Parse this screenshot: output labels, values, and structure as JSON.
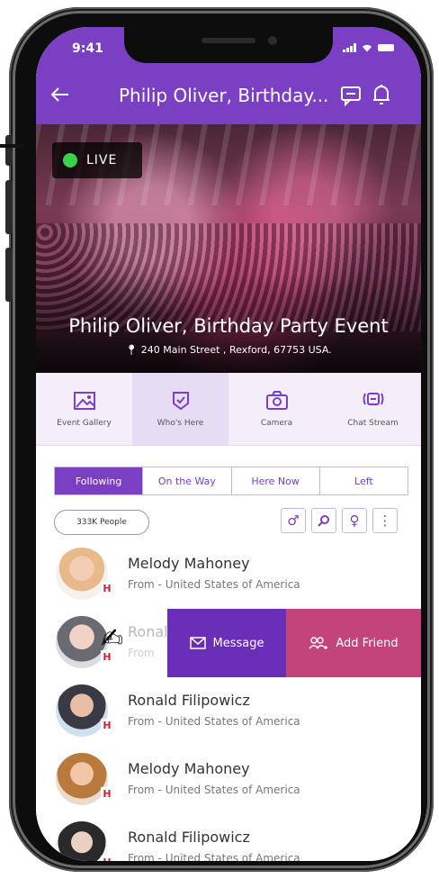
{
  "status": {
    "time": "9:41"
  },
  "header": {
    "title": "Philip Oliver, Birthday..."
  },
  "hero": {
    "live_label": "LIVE",
    "event_name": "Philip Oliver, Birthday Party Event",
    "address": "240 Main Street , Rexford, 67753 USA."
  },
  "tabs": [
    {
      "label": "Event Gallery",
      "icon": "gallery-icon"
    },
    {
      "label": "Who's Here",
      "icon": "check-shield-icon"
    },
    {
      "label": "Camera",
      "icon": "camera-icon"
    },
    {
      "label": "Chat Stream",
      "icon": "chat-stream-icon"
    }
  ],
  "segments": [
    "Following",
    "On the Way",
    "Here Now",
    "Left"
  ],
  "people_count": "333K People",
  "tools": [
    "male-filter-icon",
    "search-icon",
    "female-filter-icon",
    "more-icon"
  ],
  "people": [
    {
      "name": "Melody Mahoney",
      "from": "From - United States of America"
    },
    {
      "name": "Ronald",
      "from": "From"
    },
    {
      "name": "Ronald Filipowicz",
      "from": "From - United States of America"
    },
    {
      "name": "Melody Mahoney",
      "from": "From - United States of America"
    },
    {
      "name": "Ronald Filipowicz",
      "from": "From - United States of America"
    }
  ],
  "swipe_actions": {
    "message": "Message",
    "add_friend": "Add Friend"
  },
  "colors": {
    "primary": "#7b3fc4",
    "accent": "#c2447a",
    "live": "#3ad14b"
  }
}
